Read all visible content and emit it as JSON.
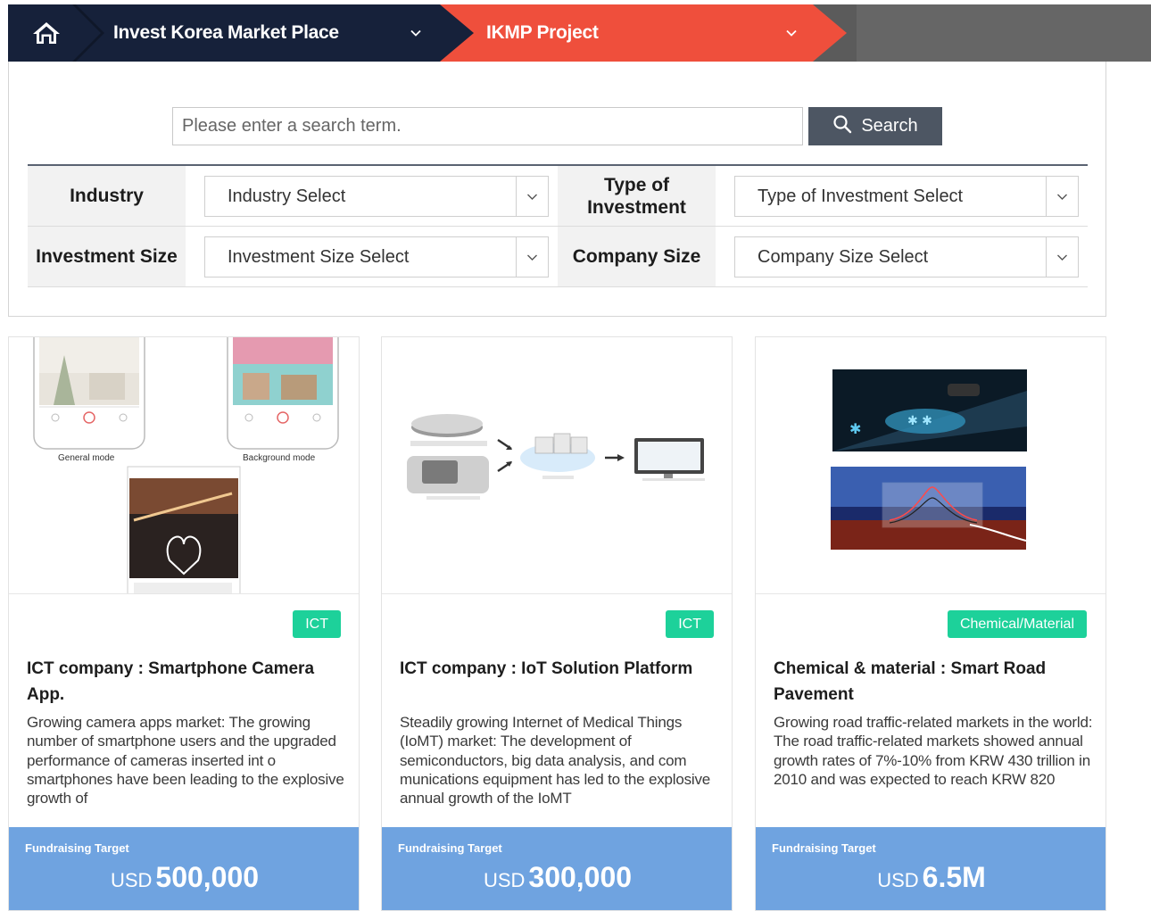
{
  "breadcrumb": {
    "home_icon": "home-icon",
    "market_label": "Invest Korea Market Place",
    "project_label": "IKMP Project"
  },
  "search": {
    "placeholder": "Please enter a search term.",
    "button_label": "Search"
  },
  "filters": {
    "industry_label": "Industry",
    "industry_value": "Industry Select",
    "investment_type_label": "Type of Investment",
    "investment_type_value": "Type of Investment Select",
    "investment_size_label": "Investment Size",
    "investment_size_value": "Investment Size Select",
    "company_size_label": "Company Size",
    "company_size_value": "Company Size Select"
  },
  "colors": {
    "nav_dark": "#16213a",
    "nav_accent": "#ef4f3c",
    "badge_green": "#1dd19a",
    "fund_blue": "#6fa3e0",
    "search_button": "#4d5663"
  },
  "cards": [
    {
      "badge": "ICT",
      "title": "ICT company : Smartphone Camera App.",
      "description": "Growing camera apps market: The growing number of smartphone users and the upgraded performance of cameras inserted int o smartphones have been leading to the explosive growth of",
      "fund_label": "Fundraising Target",
      "currency": "USD",
      "amount": "500,000",
      "image_captions": [
        "General mode",
        "Background mode"
      ]
    },
    {
      "badge": "ICT",
      "title": "ICT company : IoT Solution Platform",
      "description": "Steadily growing Internet of Medical Things (IoMT) market: The development of semiconductors, big data analysis, and com munications equipment has led to the explosive annual growth of the IoMT",
      "fund_label": "Fundraising Target",
      "currency": "USD",
      "amount": "300,000"
    },
    {
      "badge": "Chemical/Material",
      "title": "Chemical & material : Smart Road Pavement",
      "description": "Growing road traffic-related markets in the world: The road traffic-related markets showed annual growth rates of 7%-10% from KRW 430 trillion in 2010 and was expected to reach KRW 820",
      "fund_label": "Fundraising Target",
      "currency": "USD",
      "amount": "6.5M"
    }
  ]
}
